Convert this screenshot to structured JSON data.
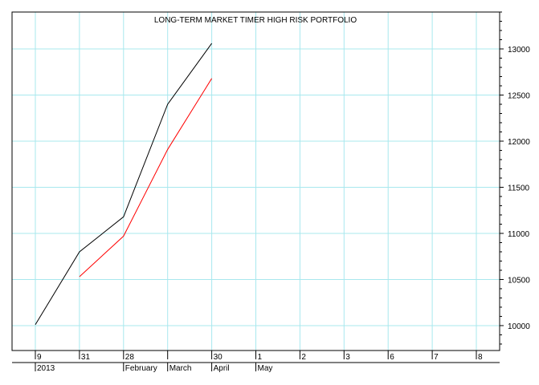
{
  "colors": {
    "background": "#ffffff",
    "grid": "#a8e8ee",
    "frame": "#000000",
    "series_black": "#000000",
    "series_red": "#ff0000"
  },
  "chart_data": {
    "type": "line",
    "title": "LONG-TERM MARKET TIMER HIGH RISK PORTFOLIO",
    "xlabel": "",
    "ylabel": "",
    "ylim": [
      9730,
      13400
    ],
    "grid": true,
    "legend": "none",
    "x_ticks": [
      "9",
      "31",
      "28",
      "",
      "30",
      "1",
      "2",
      "3",
      "6",
      "7",
      "8"
    ],
    "x_period_labels": [
      {
        "tick_index": 0,
        "label": "2013"
      },
      {
        "tick_index": 2,
        "label": "February"
      },
      {
        "tick_index": 3,
        "label": "March"
      },
      {
        "tick_index": 4,
        "label": "April"
      },
      {
        "tick_index": 5,
        "label": "May"
      }
    ],
    "y_ticks": [
      10000,
      10500,
      11000,
      11500,
      12000,
      12500,
      13000
    ],
    "series": [
      {
        "color": "#000000",
        "points": [
          [
            0,
            10010
          ],
          [
            1,
            10800
          ],
          [
            2,
            11180
          ],
          [
            3,
            12400
          ],
          [
            4,
            13060
          ]
        ]
      },
      {
        "color": "#ff0000",
        "points": [
          [
            1,
            10530
          ],
          [
            2,
            10970
          ],
          [
            3,
            11910
          ],
          [
            4,
            12680
          ]
        ]
      }
    ]
  }
}
